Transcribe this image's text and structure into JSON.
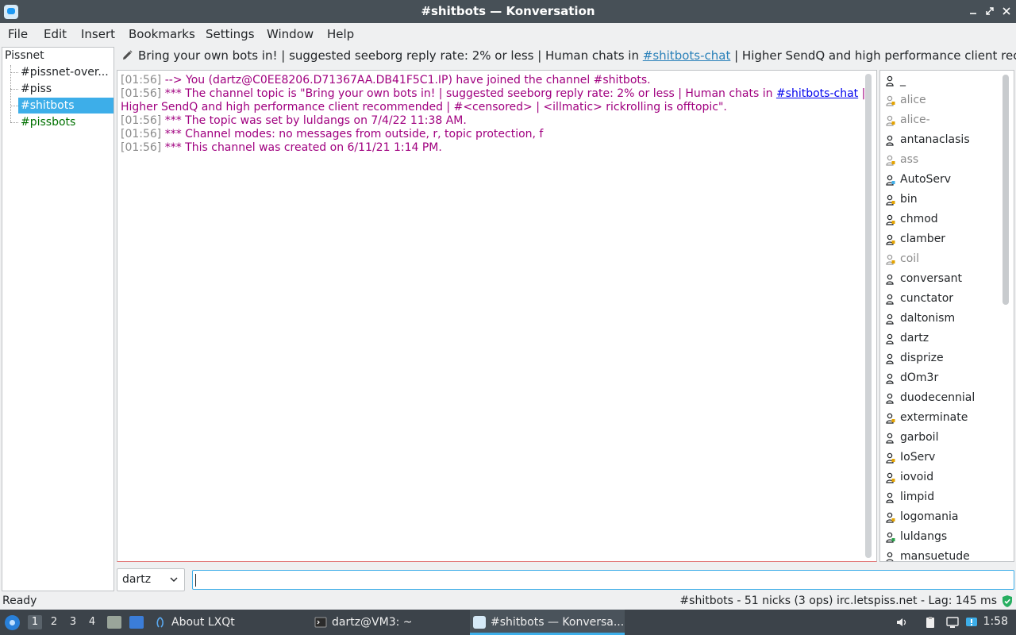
{
  "window": {
    "title": "#shitbots — Konversation"
  },
  "menu": [
    "File",
    "Edit",
    "Insert",
    "Bookmarks",
    "Settings",
    "Window",
    "Help"
  ],
  "tree": {
    "root": "Pissnet",
    "items": [
      {
        "label": "#pissnet-over...",
        "state": "normal"
      },
      {
        "label": "#piss",
        "state": "normal"
      },
      {
        "label": "#shitbots",
        "state": "selected"
      },
      {
        "label": "#pissbots",
        "state": "activity"
      }
    ]
  },
  "topic": {
    "part1": "Bring your own bots in! | suggested seeborg reply rate: 2% or less | Human chats in ",
    "link": "#shitbots-chat",
    "part2": " | Higher SendQ and high performance client recommended | ..."
  },
  "chat": {
    "lines": [
      {
        "ts": "[01:56]",
        "text": " --> You (dartz@C0EE8206.D71367AA.DB41F5C1.IP) have joined the channel #shitbots."
      },
      {
        "ts": "[01:56]",
        "text": " *** The channel topic is \"Bring your own bots in! | suggested seeborg reply rate: 2% or less | Human chats in ",
        "link": "#shitbots-chat",
        "after": " |"
      },
      {
        "ts": "",
        "text": "Higher SendQ and high performance client recommended | #<censored> | <illmatic> rickrolling is offtopic\"."
      },
      {
        "ts": "[01:56]",
        "text": " *** The topic was set by luldangs on 7/4/22 11:38 AM."
      },
      {
        "ts": "[01:56]",
        "text": " *** Channel modes: no messages from outside, r, topic protection, f"
      },
      {
        "ts": "[01:56]",
        "text": " *** This channel was created on 6/11/21 1:14 PM."
      }
    ]
  },
  "nicks": [
    {
      "name": "_",
      "away": false,
      "mode": "normal"
    },
    {
      "name": "alice",
      "away": true,
      "mode": "op"
    },
    {
      "name": "alice-",
      "away": true,
      "mode": "op"
    },
    {
      "name": "antanaclasis",
      "away": false,
      "mode": "normal"
    },
    {
      "name": "ass",
      "away": true,
      "mode": "op"
    },
    {
      "name": "AutoServ",
      "away": false,
      "mode": "service"
    },
    {
      "name": "bin",
      "away": false,
      "mode": "op"
    },
    {
      "name": "chmod",
      "away": false,
      "mode": "op"
    },
    {
      "name": "clamber",
      "away": false,
      "mode": "op"
    },
    {
      "name": "coil",
      "away": true,
      "mode": "op"
    },
    {
      "name": "conversant",
      "away": false,
      "mode": "normal"
    },
    {
      "name": "cunctator",
      "away": false,
      "mode": "normal"
    },
    {
      "name": "daltonism",
      "away": false,
      "mode": "normal"
    },
    {
      "name": "dartz",
      "away": false,
      "mode": "normal"
    },
    {
      "name": "disprize",
      "away": false,
      "mode": "normal"
    },
    {
      "name": "dOm3r",
      "away": false,
      "mode": "normal"
    },
    {
      "name": "duodecennial",
      "away": false,
      "mode": "normal"
    },
    {
      "name": "exterminate",
      "away": false,
      "mode": "op"
    },
    {
      "name": "garboil",
      "away": false,
      "mode": "normal"
    },
    {
      "name": "IoServ",
      "away": false,
      "mode": "op"
    },
    {
      "name": "iovoid",
      "away": false,
      "mode": "op"
    },
    {
      "name": "limpid",
      "away": false,
      "mode": "normal"
    },
    {
      "name": "logomania",
      "away": false,
      "mode": "op"
    },
    {
      "name": "luldangs",
      "away": false,
      "mode": "halfop"
    },
    {
      "name": "mansuetude",
      "away": false,
      "mode": "normal"
    }
  ],
  "input": {
    "nick": "dartz",
    "value": ""
  },
  "status": {
    "left": "Ready",
    "right": "#shitbots - 51 nicks (3 ops)  irc.letspiss.net - Lag: 145 ms"
  },
  "taskbar": {
    "desktops": [
      "1",
      "2",
      "3",
      "4"
    ],
    "tasks": [
      "About LXQt",
      "dartz@VM3: ~",
      "#shitbots — Konversa..."
    ],
    "clock": "1:58"
  },
  "colors": {
    "accent": "#3daee9",
    "message": "#a0007f",
    "timestamp": "#8a8a8a",
    "activity": "#007000"
  }
}
